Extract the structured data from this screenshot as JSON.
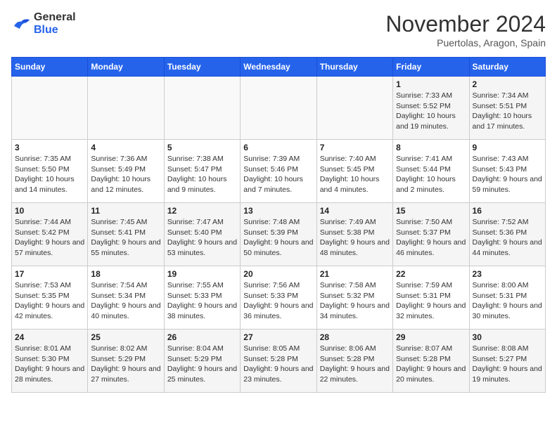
{
  "header": {
    "logo_line1": "General",
    "logo_line2": "Blue",
    "month": "November 2024",
    "location": "Puertolas, Aragon, Spain"
  },
  "weekdays": [
    "Sunday",
    "Monday",
    "Tuesday",
    "Wednesday",
    "Thursday",
    "Friday",
    "Saturday"
  ],
  "weeks": [
    [
      {
        "day": "",
        "info": ""
      },
      {
        "day": "",
        "info": ""
      },
      {
        "day": "",
        "info": ""
      },
      {
        "day": "",
        "info": ""
      },
      {
        "day": "",
        "info": ""
      },
      {
        "day": "1",
        "info": "Sunrise: 7:33 AM\nSunset: 5:52 PM\nDaylight: 10 hours and 19 minutes."
      },
      {
        "day": "2",
        "info": "Sunrise: 7:34 AM\nSunset: 5:51 PM\nDaylight: 10 hours and 17 minutes."
      }
    ],
    [
      {
        "day": "3",
        "info": "Sunrise: 7:35 AM\nSunset: 5:50 PM\nDaylight: 10 hours and 14 minutes."
      },
      {
        "day": "4",
        "info": "Sunrise: 7:36 AM\nSunset: 5:49 PM\nDaylight: 10 hours and 12 minutes."
      },
      {
        "day": "5",
        "info": "Sunrise: 7:38 AM\nSunset: 5:47 PM\nDaylight: 10 hours and 9 minutes."
      },
      {
        "day": "6",
        "info": "Sunrise: 7:39 AM\nSunset: 5:46 PM\nDaylight: 10 hours and 7 minutes."
      },
      {
        "day": "7",
        "info": "Sunrise: 7:40 AM\nSunset: 5:45 PM\nDaylight: 10 hours and 4 minutes."
      },
      {
        "day": "8",
        "info": "Sunrise: 7:41 AM\nSunset: 5:44 PM\nDaylight: 10 hours and 2 minutes."
      },
      {
        "day": "9",
        "info": "Sunrise: 7:43 AM\nSunset: 5:43 PM\nDaylight: 9 hours and 59 minutes."
      }
    ],
    [
      {
        "day": "10",
        "info": "Sunrise: 7:44 AM\nSunset: 5:42 PM\nDaylight: 9 hours and 57 minutes."
      },
      {
        "day": "11",
        "info": "Sunrise: 7:45 AM\nSunset: 5:41 PM\nDaylight: 9 hours and 55 minutes."
      },
      {
        "day": "12",
        "info": "Sunrise: 7:47 AM\nSunset: 5:40 PM\nDaylight: 9 hours and 53 minutes."
      },
      {
        "day": "13",
        "info": "Sunrise: 7:48 AM\nSunset: 5:39 PM\nDaylight: 9 hours and 50 minutes."
      },
      {
        "day": "14",
        "info": "Sunrise: 7:49 AM\nSunset: 5:38 PM\nDaylight: 9 hours and 48 minutes."
      },
      {
        "day": "15",
        "info": "Sunrise: 7:50 AM\nSunset: 5:37 PM\nDaylight: 9 hours and 46 minutes."
      },
      {
        "day": "16",
        "info": "Sunrise: 7:52 AM\nSunset: 5:36 PM\nDaylight: 9 hours and 44 minutes."
      }
    ],
    [
      {
        "day": "17",
        "info": "Sunrise: 7:53 AM\nSunset: 5:35 PM\nDaylight: 9 hours and 42 minutes."
      },
      {
        "day": "18",
        "info": "Sunrise: 7:54 AM\nSunset: 5:34 PM\nDaylight: 9 hours and 40 minutes."
      },
      {
        "day": "19",
        "info": "Sunrise: 7:55 AM\nSunset: 5:33 PM\nDaylight: 9 hours and 38 minutes."
      },
      {
        "day": "20",
        "info": "Sunrise: 7:56 AM\nSunset: 5:33 PM\nDaylight: 9 hours and 36 minutes."
      },
      {
        "day": "21",
        "info": "Sunrise: 7:58 AM\nSunset: 5:32 PM\nDaylight: 9 hours and 34 minutes."
      },
      {
        "day": "22",
        "info": "Sunrise: 7:59 AM\nSunset: 5:31 PM\nDaylight: 9 hours and 32 minutes."
      },
      {
        "day": "23",
        "info": "Sunrise: 8:00 AM\nSunset: 5:31 PM\nDaylight: 9 hours and 30 minutes."
      }
    ],
    [
      {
        "day": "24",
        "info": "Sunrise: 8:01 AM\nSunset: 5:30 PM\nDaylight: 9 hours and 28 minutes."
      },
      {
        "day": "25",
        "info": "Sunrise: 8:02 AM\nSunset: 5:29 PM\nDaylight: 9 hours and 27 minutes."
      },
      {
        "day": "26",
        "info": "Sunrise: 8:04 AM\nSunset: 5:29 PM\nDaylight: 9 hours and 25 minutes."
      },
      {
        "day": "27",
        "info": "Sunrise: 8:05 AM\nSunset: 5:28 PM\nDaylight: 9 hours and 23 minutes."
      },
      {
        "day": "28",
        "info": "Sunrise: 8:06 AM\nSunset: 5:28 PM\nDaylight: 9 hours and 22 minutes."
      },
      {
        "day": "29",
        "info": "Sunrise: 8:07 AM\nSunset: 5:28 PM\nDaylight: 9 hours and 20 minutes."
      },
      {
        "day": "30",
        "info": "Sunrise: 8:08 AM\nSunset: 5:27 PM\nDaylight: 9 hours and 19 minutes."
      }
    ]
  ]
}
